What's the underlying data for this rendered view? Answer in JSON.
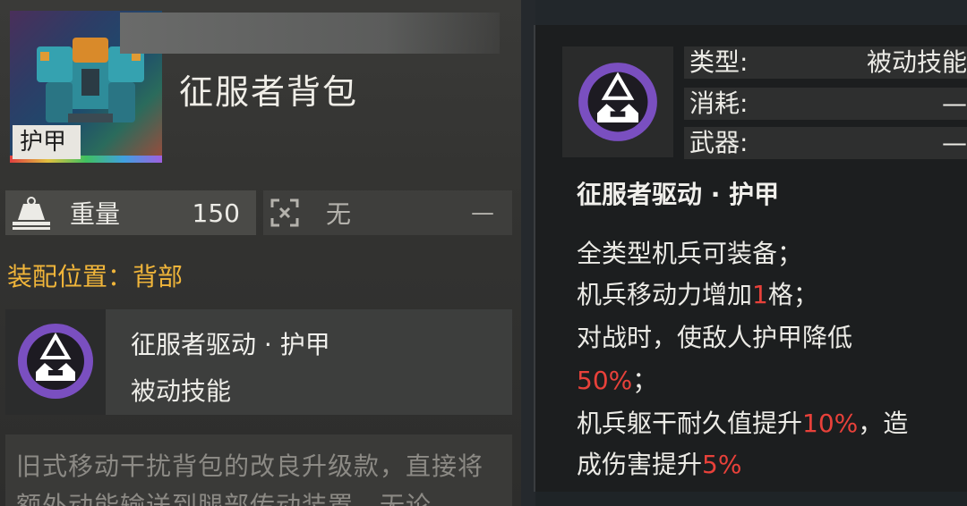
{
  "item": {
    "title": "征服者背包",
    "tag": "护甲",
    "weight_label": "重量",
    "weight_value": "150",
    "slot_label": "无",
    "slot_value": "—",
    "mount_position": "装配位置：背部",
    "description": "旧式移动干扰背包的改良升级款，直接将额外动能输送到腿部传动装置，无论"
  },
  "skill": {
    "name": "征服者驱动 · 护甲",
    "type": "被动技能"
  },
  "tooltip": {
    "type_label": "类型:",
    "type_value": "被动技能",
    "cost_label": "消耗:",
    "cost_value": "—",
    "weapon_label": "武器:",
    "weapon_value": "—",
    "title": "征服者驱动 · 护甲",
    "line1": "全类型机兵可装备；",
    "line2_pre": "机兵移动力增加",
    "line2_hl": "1",
    "line2_post": "格；",
    "line3": "对战时，使敌人护甲降低",
    "line4_hl": "50%",
    "line4_post": "；",
    "line5_pre": "机兵躯干耐久值提升",
    "line5_hl": "10%",
    "line5_post": "，造",
    "line6_pre": "成伤害提升",
    "line6_hl": "5%"
  },
  "colors": {
    "accent_orange": "#f0b53a",
    "highlight_red": "#e8413a",
    "emblem_purple": "#7a4fc0"
  },
  "icons": {
    "weight": "weight-icon",
    "slot": "slot-icon",
    "skill": "conqueror-emblem-icon"
  }
}
